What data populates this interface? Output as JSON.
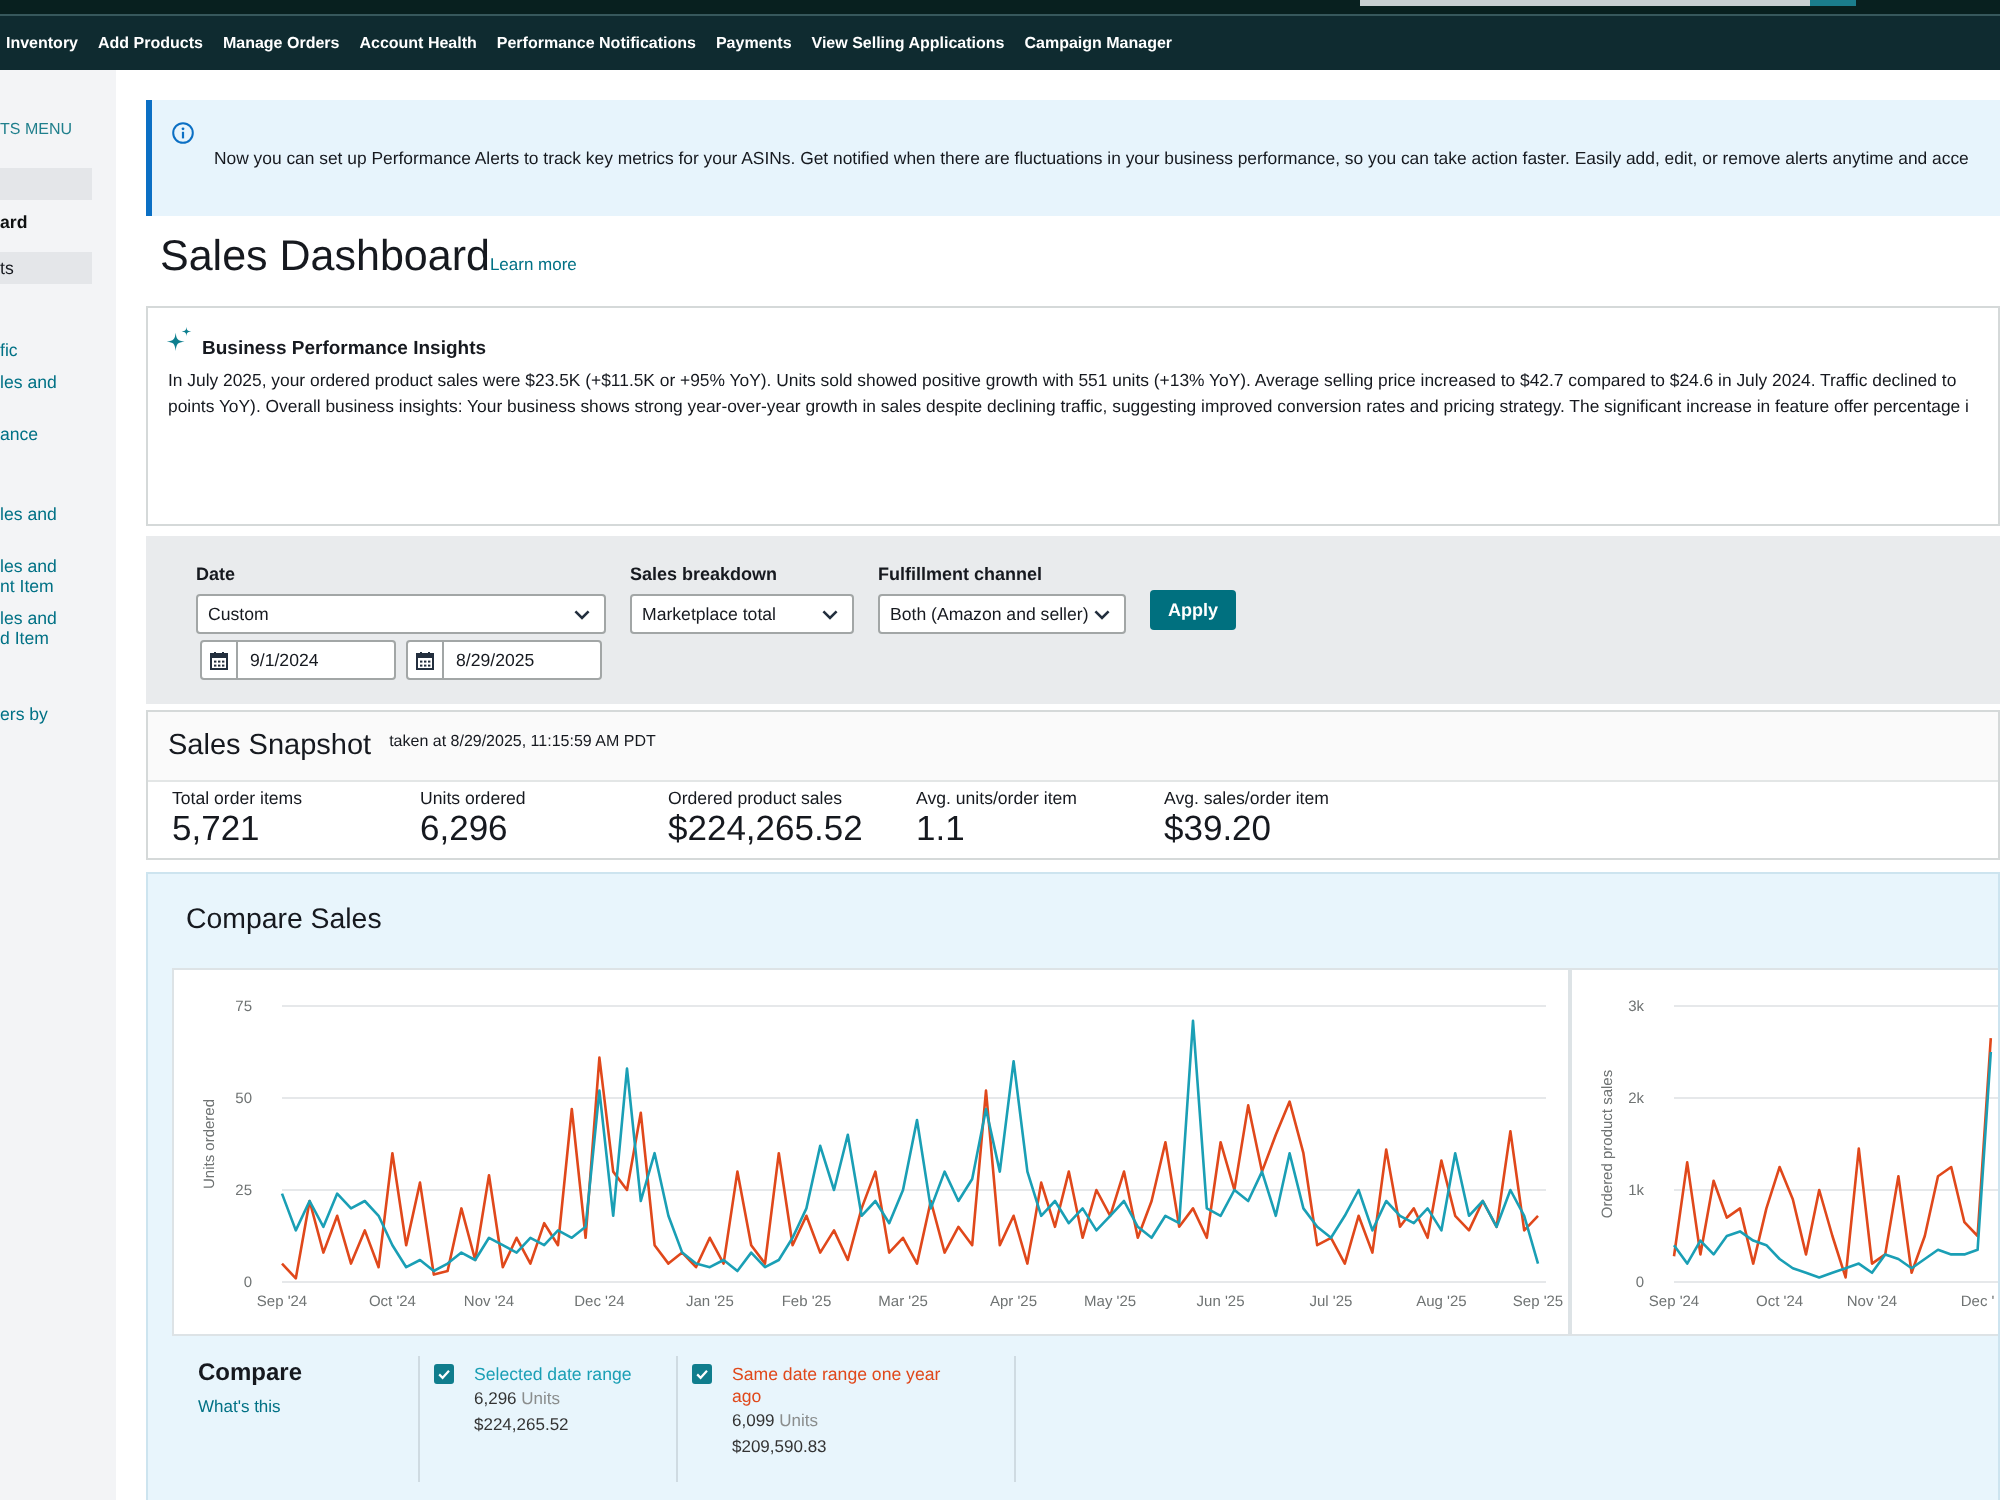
{
  "nav": {
    "items": [
      "Inventory",
      "Add Products",
      "Manage Orders",
      "Account Health",
      "Performance Notifications",
      "Payments",
      "View Selling Applications",
      "Campaign Manager"
    ]
  },
  "sidebar": {
    "heading": "TS MENU",
    "items": [
      {
        "kind": "section",
        "selected": false
      },
      {
        "kind": "link",
        "label": "ard",
        "selected": true
      },
      {
        "kind": "section",
        "label": "ts",
        "selected": false
      },
      {
        "kind": "link",
        "label": "fic",
        "selected": false
      },
      {
        "kind": "link",
        "label": "les and",
        "selected": false
      },
      {
        "kind": "link",
        "label": "ance",
        "selected": false
      },
      {
        "kind": "link",
        "label": "les and",
        "selected": false
      },
      {
        "kind": "link",
        "label": "les and nt Item",
        "selected": false
      },
      {
        "kind": "link",
        "label": "les and d Item",
        "selected": false
      },
      {
        "kind": "link",
        "label": "ers by",
        "selected": false
      }
    ]
  },
  "banner": {
    "text": "Now you can set up Performance Alerts to track key metrics for your ASINs. Get notified when there are fluctuations in your business performance, so you can take action faster. Easily add, edit, or remove alerts anytime and acce"
  },
  "header": {
    "title": "Sales Dashboard",
    "link": "Learn more"
  },
  "insights": {
    "title": "Business Performance Insights",
    "lines": [
      "In July 2025, your ordered product sales were $23.5K (+$11.5K or +95% YoY). Units sold showed positive growth with 551 units (+13% YoY). Average selling price increased to $42.7 compared to $24.6 in July 2024. Traffic declined to",
      "points YoY). Overall business insights: Your business shows strong year-over-year growth in sales despite declining traffic, suggesting improved conversion rates and pricing strategy. The significant increase in feature offer percentage i"
    ]
  },
  "filters": {
    "date": {
      "label": "Date",
      "value": "Custom",
      "start_date": "9/1/2024",
      "end_date": "8/29/2025"
    },
    "dropdowns": [
      {
        "label": "Sales breakdown",
        "value": "Marketplace total"
      },
      {
        "label": "Fulfillment channel",
        "value": "Both (Amazon and seller)"
      }
    ],
    "apply": "Apply"
  },
  "snapshot": {
    "title": "Sales Snapshot",
    "taken_at": "taken at 8/29/2025, 11:15:59 AM PDT",
    "metrics": [
      {
        "label": "Total order items",
        "value": "5,721"
      },
      {
        "label": "Units ordered",
        "value": "6,296"
      },
      {
        "label": "Ordered product sales",
        "value": "$224,265.52"
      },
      {
        "label": "Avg. units/order item",
        "value": "1.1"
      },
      {
        "label": "Avg. sales/order item",
        "value": "$39.20"
      }
    ]
  },
  "compare_sales": {
    "title": "Compare Sales",
    "charts": [
      {
        "chart_data": {
          "type": "line",
          "ylabel": "Units ordered",
          "ylim": [
            0,
            75
          ],
          "yticks": [
            0,
            25,
            50,
            75
          ],
          "categories": [
            "Sep '24",
            null,
            null,
            null,
            null,
            null,
            null,
            null,
            "Oct '24",
            null,
            null,
            null,
            null,
            null,
            null,
            "Nov '24",
            null,
            null,
            null,
            null,
            null,
            null,
            null,
            "Dec '24",
            null,
            null,
            null,
            null,
            null,
            null,
            null,
            "Jan '25",
            null,
            null,
            null,
            null,
            null,
            null,
            "Feb '25",
            null,
            null,
            null,
            null,
            null,
            null,
            "Mar '25",
            null,
            null,
            null,
            null,
            null,
            null,
            null,
            "Apr '25",
            null,
            null,
            null,
            null,
            null,
            null,
            "May '25",
            null,
            null,
            null,
            null,
            null,
            null,
            null,
            "Jun '25",
            null,
            null,
            null,
            null,
            null,
            null,
            null,
            "Jul '25",
            null,
            null,
            null,
            null,
            null,
            null,
            null,
            "Aug '25",
            null,
            null,
            null,
            null,
            null,
            null,
            "Sep '25"
          ],
          "series": [
            {
              "color": "#1a9fb5",
              "values": [
                24,
                14,
                22,
                15,
                24,
                20,
                22,
                18,
                10,
                4,
                6,
                3,
                5,
                8,
                6,
                12,
                10,
                8,
                12,
                10,
                14,
                12,
                15,
                52,
                18,
                58,
                22,
                35,
                18,
                8,
                5,
                4,
                6,
                3,
                8,
                4,
                6,
                12,
                20,
                37,
                25,
                40,
                18,
                22,
                16,
                25,
                44,
                20,
                30,
                22,
                28,
                47,
                30,
                60,
                30,
                18,
                22,
                16,
                20,
                14,
                18,
                22,
                15,
                12,
                18,
                16,
                71,
                20,
                18,
                25,
                22,
                30,
                18,
                35,
                20,
                15,
                12,
                18,
                25,
                14,
                22,
                18,
                16,
                20,
                14,
                35,
                18,
                22,
                15,
                25,
                18,
                5
              ]
            },
            {
              "color": "#e0481b",
              "values": [
                5,
                1,
                22,
                8,
                18,
                5,
                14,
                4,
                35,
                10,
                27,
                2,
                3,
                20,
                6,
                29,
                4,
                12,
                5,
                16,
                10,
                47,
                12,
                61,
                30,
                25,
                46,
                10,
                5,
                8,
                4,
                12,
                5,
                30,
                10,
                5,
                35,
                10,
                18,
                8,
                14,
                6,
                20,
                30,
                8,
                12,
                5,
                22,
                8,
                15,
                10,
                52,
                10,
                18,
                5,
                27,
                15,
                30,
                12,
                25,
                18,
                30,
                12,
                22,
                38,
                15,
                20,
                12,
                38,
                25,
                48,
                30,
                40,
                49,
                35,
                10,
                12,
                5,
                18,
                8,
                36,
                15,
                20,
                12,
                33,
                18,
                14,
                22,
                15,
                41,
                14,
                18
              ]
            }
          ]
        }
      },
      {
        "chart_data": {
          "type": "line",
          "ylabel": "Ordered product sales",
          "ylim": [
            0,
            3000
          ],
          "yticks": [
            {
              "value": 0,
              "label": "0"
            },
            {
              "value": 1000,
              "label": "1k"
            },
            {
              "value": 2000,
              "label": "2k"
            },
            {
              "value": 3000,
              "label": "3k"
            }
          ],
          "categories": [
            "Sep '24",
            null,
            null,
            null,
            null,
            null,
            null,
            null,
            "Oct '24",
            null,
            null,
            null,
            null,
            null,
            null,
            "Nov '24",
            null,
            null,
            null,
            null,
            null,
            null,
            null,
            "Dec '",
            null
          ],
          "series": [
            {
              "color": "#1a9fb5",
              "values": [
                400,
                200,
                450,
                300,
                500,
                550,
                450,
                400,
                250,
                150,
                100,
                50,
                100,
                150,
                200,
                100,
                300,
                250,
                150,
                250,
                350,
                300,
                300,
                350,
                2500
              ]
            },
            {
              "color": "#e0481b",
              "values": [
                280,
                1300,
                300,
                1100,
                700,
                800,
                200,
                800,
                1250,
                900,
                300,
                1000,
                500,
                50,
                1450,
                200,
                300,
                1150,
                100,
                500,
                1150,
                1250,
                650,
                500,
                2650
              ]
            }
          ]
        }
      }
    ],
    "compare": {
      "title": "Compare",
      "link": "What's this",
      "items": [
        {
          "label": "Selected date range",
          "color": "#1a9fb5",
          "checked": true,
          "units": "6,296",
          "units_label": "Units",
          "sales": "$224,265.52"
        },
        {
          "label": "Same date range one year ago",
          "color": "#e0481b",
          "checked": true,
          "units": "6,099",
          "units_label": "Units",
          "sales": "$209,590.83"
        }
      ]
    }
  }
}
